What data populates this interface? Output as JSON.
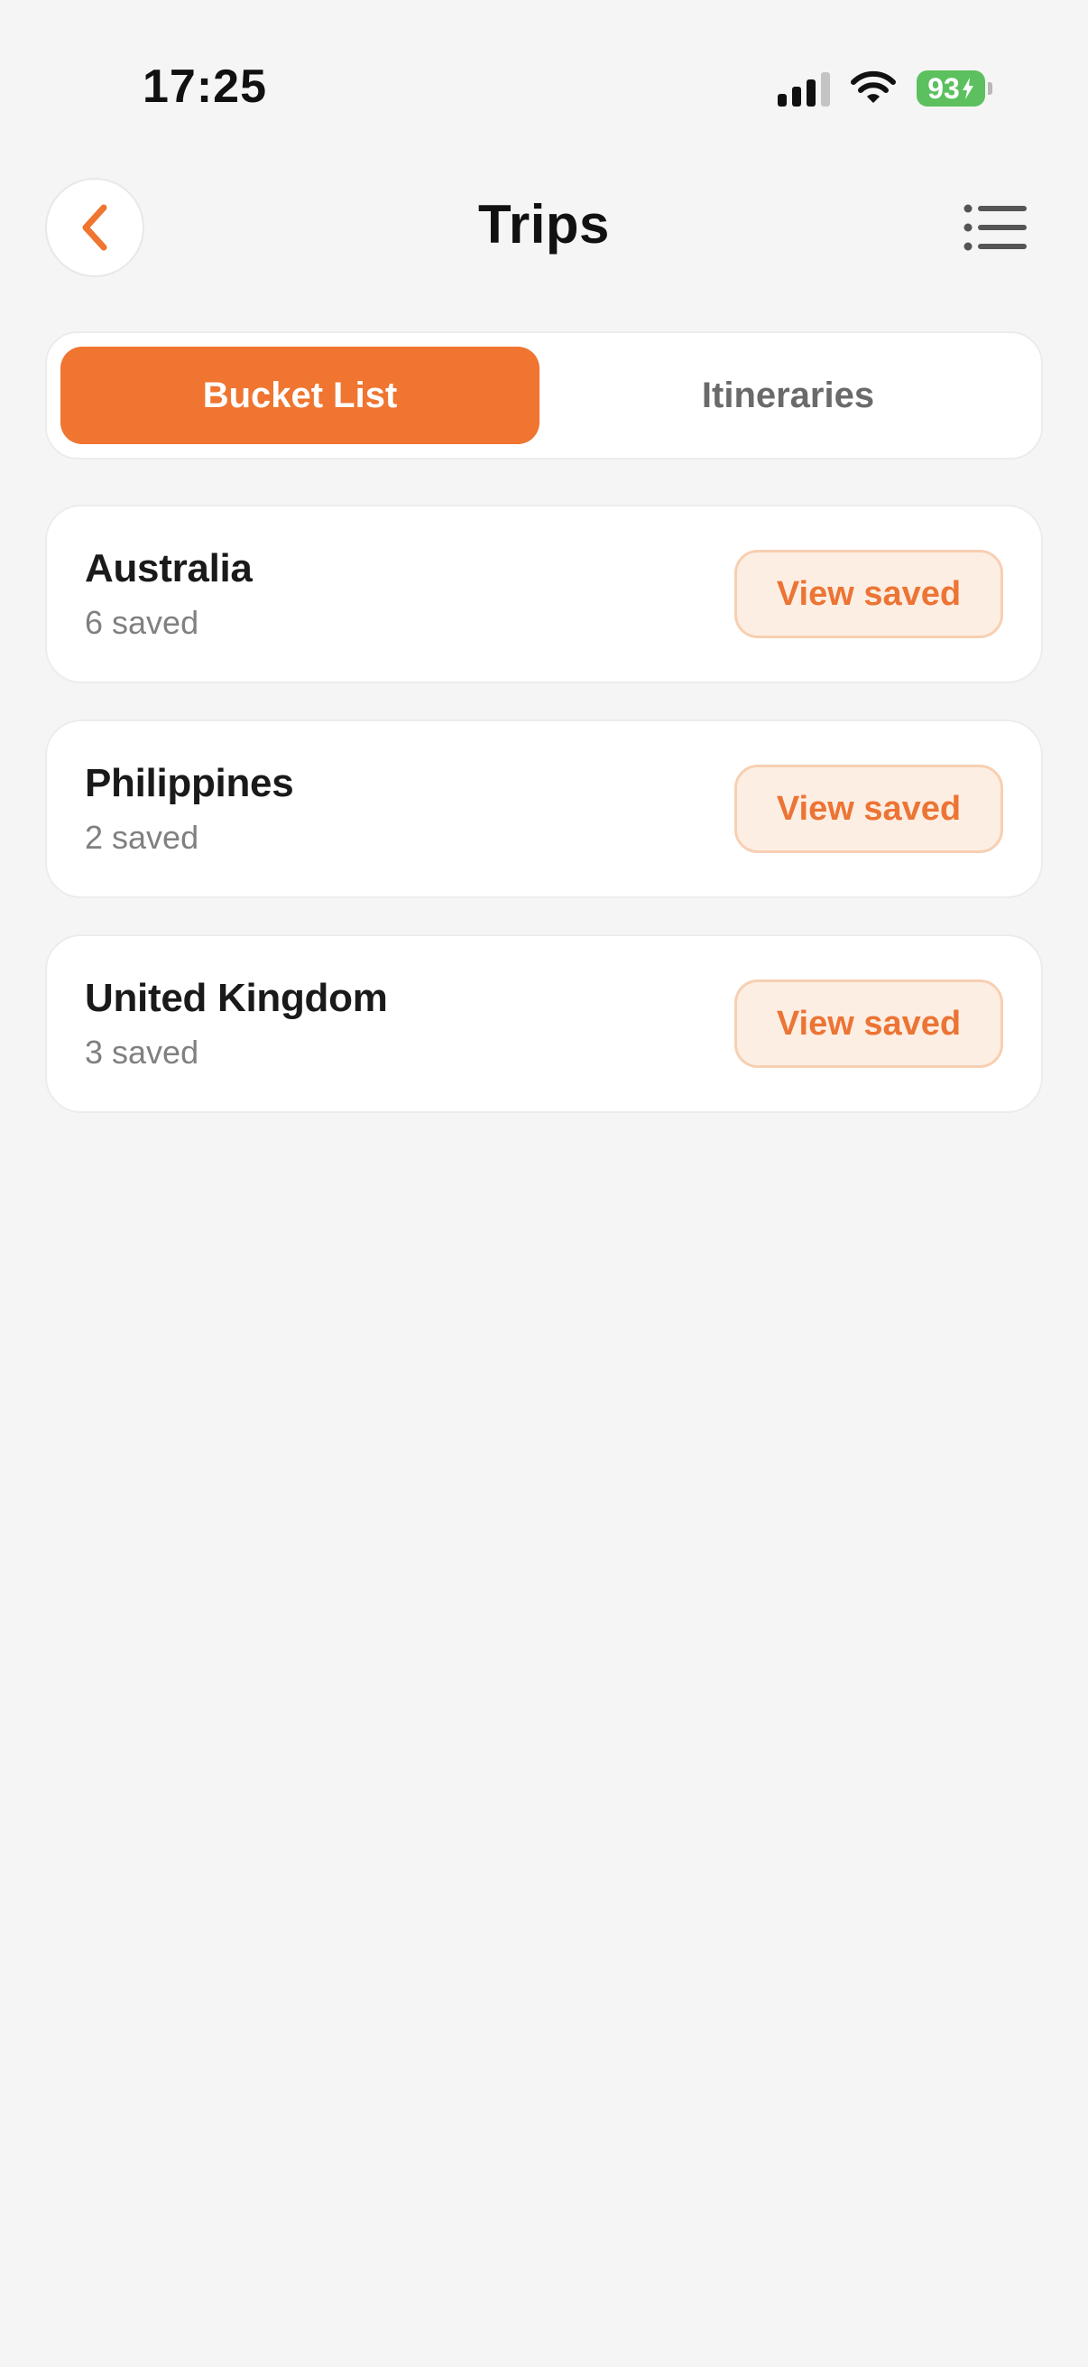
{
  "status_bar": {
    "time": "17:25",
    "battery": "93",
    "icons": [
      "cellular-signal-icon",
      "wifi-icon",
      "battery-charging-icon"
    ]
  },
  "header": {
    "title": "Trips",
    "back_icon": "chevron-left-icon",
    "menu_icon": "list-icon"
  },
  "tabs": [
    {
      "label": "Bucket List",
      "active": true
    },
    {
      "label": "Itineraries",
      "active": false
    }
  ],
  "destinations": [
    {
      "name": "Australia",
      "count": "6 saved",
      "action": "View saved"
    },
    {
      "name": "Philippines",
      "count": "2 saved",
      "action": "View saved"
    },
    {
      "name": "United Kingdom",
      "count": "3 saved",
      "action": "View saved"
    }
  ],
  "colors": {
    "accent": "#ef7530",
    "accent_soft": "#fdeee3",
    "background": "#f5f5f5",
    "battery": "#5cc05f"
  }
}
